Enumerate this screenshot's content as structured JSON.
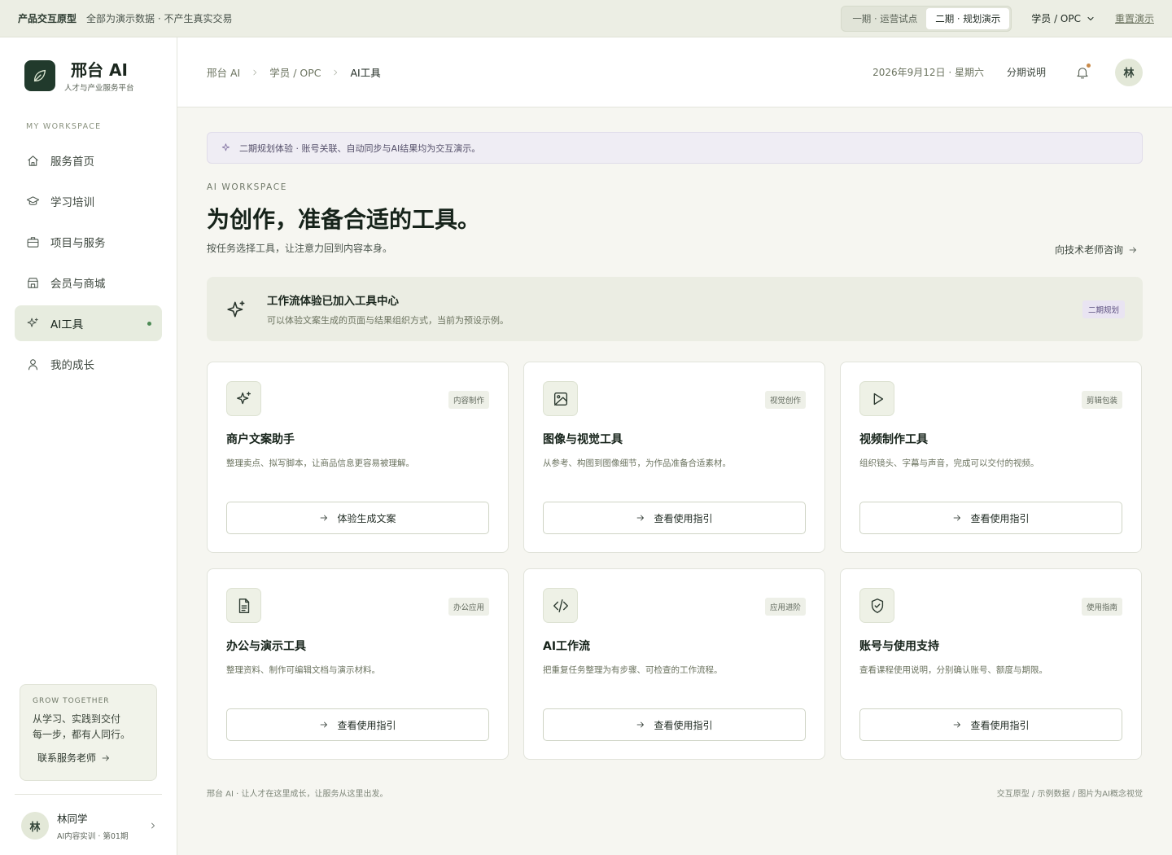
{
  "topbar": {
    "proto_label": "产品交互原型",
    "note": "全部为演示数据 · 不产生真实交易",
    "phases": [
      "一期 · 运营试点",
      "二期 · 规划演示"
    ],
    "active_phase": 1,
    "role": "学员 / OPC",
    "reset": "重置演示"
  },
  "brand": {
    "name": "邢台 AI",
    "subtitle": "人才与产业服务平台",
    "logo_icon": "leaf-icon"
  },
  "sidebar": {
    "section_label": "MY WORKSPACE",
    "items": [
      {
        "label": "服务首页",
        "icon": "home-icon"
      },
      {
        "label": "学习培训",
        "icon": "graduation-cap-icon"
      },
      {
        "label": "项目与服务",
        "icon": "briefcase-icon"
      },
      {
        "label": "会员与商城",
        "icon": "store-icon"
      },
      {
        "label": "AI工具",
        "icon": "sparkle-icon",
        "active": true
      },
      {
        "label": "我的成长",
        "icon": "user-icon"
      }
    ],
    "grow": {
      "label": "GROW TOGETHER",
      "text_line1": "从学习、实践到交付",
      "text_line2": "每一步，都有人同行。",
      "cta": "联系服务老师"
    },
    "user": {
      "avatar": "林",
      "name": "林同学",
      "meta": "AI内容实训 · 第01期"
    }
  },
  "header": {
    "breadcrumb": [
      "邢台 AI",
      "学员 / OPC",
      "AI工具"
    ],
    "date": "2026年9月12日 · 星期六",
    "plan_link": "分期说明",
    "avatar": "林"
  },
  "main": {
    "notice": "二期规划体验 · 账号关联、自动同步与AI结果均为交互演示。",
    "kicker": "AI WORKSPACE",
    "title": "为创作，准备合适的工具。",
    "subtitle": "按任务选择工具，让注意力回到内容本身。",
    "consult": "向技术老师咨询",
    "banner": {
      "title": "工作流体验已加入工具中心",
      "desc": "可以体验文案生成的页面与结果组织方式，当前为预设示例。",
      "badge": "二期规划"
    },
    "cards": [
      {
        "icon": "sparkle-icon",
        "tag": "内容制作",
        "title": "商户文案助手",
        "desc": "整理卖点、拟写脚本，让商品信息更容易被理解。",
        "button": "体验生成文案"
      },
      {
        "icon": "image-icon",
        "tag": "视觉创作",
        "title": "图像与视觉工具",
        "desc": "从参考、构图到图像细节，为作品准备合适素材。",
        "button": "查看使用指引"
      },
      {
        "icon": "play-icon",
        "tag": "剪辑包装",
        "title": "视频制作工具",
        "desc": "组织镜头、字幕与声音，完成可以交付的视频。",
        "button": "查看使用指引"
      },
      {
        "icon": "document-icon",
        "tag": "办公应用",
        "title": "办公与演示工具",
        "desc": "整理资料、制作可编辑文档与演示材料。",
        "button": "查看使用指引"
      },
      {
        "icon": "code-icon",
        "tag": "应用进阶",
        "title": "AI工作流",
        "desc": "把重复任务整理为有步骤、可检查的工作流程。",
        "button": "查看使用指引"
      },
      {
        "icon": "shield-check-icon",
        "tag": "使用指南",
        "title": "账号与使用支持",
        "desc": "查看课程使用说明，分别确认账号、额度与期限。",
        "button": "查看使用指引"
      }
    ],
    "footer_left": "邢台 AI · 让人才在这里成长，让服务从这里出发。",
    "footer_right": "交互原型 / 示例数据 / 图片为AI概念视觉"
  }
}
